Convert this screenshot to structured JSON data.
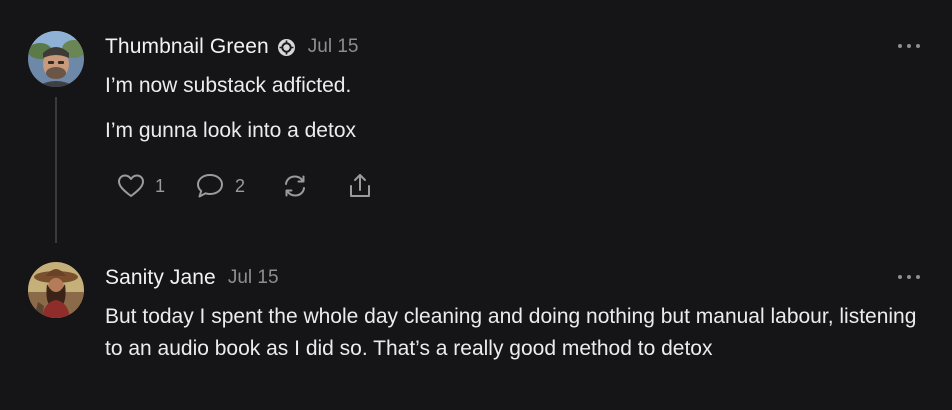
{
  "posts": [
    {
      "author": "Thumbnail Green",
      "date": "Jul 15",
      "paragraphs": [
        "I’m now substack adficted.",
        "I’m gunna look into a detox"
      ],
      "actions": {
        "like_count": "1",
        "comment_count": "2"
      },
      "avatar_icon": "avatar-photo",
      "badge_icon": "subscriber-badge-icon"
    },
    {
      "author": "Sanity Jane",
      "date": "Jul 15",
      "paragraphs": [
        "But today I spent the whole day cleaning and doing nothing but manual labour, listening to an audio book as I did so. That’s a really good method to detox"
      ],
      "avatar_icon": "avatar-illustration"
    }
  ],
  "colors": {
    "background": "#151517",
    "text": "#ececec",
    "muted": "#8d8d92",
    "thread_line": "#3a3a3d"
  }
}
